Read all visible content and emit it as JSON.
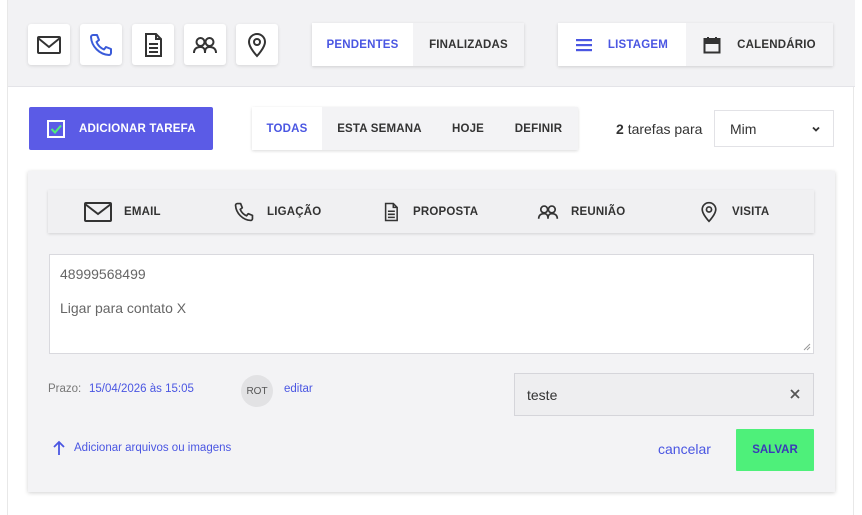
{
  "toolbar": {
    "icons": [
      {
        "name": "mail-icon",
        "active": false
      },
      {
        "name": "phone-icon",
        "active": true
      },
      {
        "name": "document-icon",
        "active": false
      },
      {
        "name": "people-icon",
        "active": false
      },
      {
        "name": "location-pin-icon",
        "active": false
      }
    ],
    "status_tabs": {
      "pending": "PENDENTES",
      "done": "FINALIZADAS",
      "selected": "PENDENTES"
    },
    "view_tabs": {
      "list": "LISTAGEM",
      "calendar": "CALENDÁRIO",
      "selected": "LISTAGEM"
    }
  },
  "actions": {
    "add_task": "ADICIONAR TAREFA"
  },
  "filters": {
    "items": [
      "TODAS",
      "ESTA SEMANA",
      "HOJE",
      "DEFINIR"
    ],
    "selected": "TODAS"
  },
  "summary": {
    "count": "2",
    "text": "tarefas para",
    "assignee": "Mim"
  },
  "form": {
    "types": [
      "EMAIL",
      "LIGAÇÃO",
      "PROPOSTA",
      "REUNIÃO",
      "VISITA"
    ],
    "selected_type": "LIGAÇÃO",
    "text_line1": "48999568499",
    "text_line2": "Ligar para contato X",
    "deadline_label": "Prazo:",
    "deadline_value": "15/04/2026 às 15:05",
    "avatar_initials": "ROT",
    "edit_label": "editar",
    "tag_value": "teste",
    "upload_label": "Adicionar arquivos ou imagens",
    "cancel_label": "cancelar",
    "save_label": "SALVAR"
  },
  "colors": {
    "accent": "#4a56e2",
    "add_button": "#5b5be6",
    "save_button": "#4ef07a",
    "background": "#f2f2f4"
  }
}
